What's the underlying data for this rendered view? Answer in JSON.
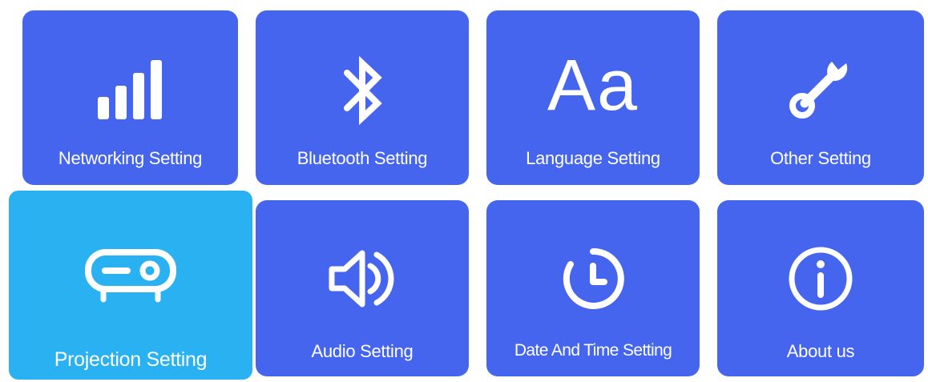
{
  "tiles": [
    {
      "id": "networking",
      "label": "Networking Setting",
      "icon": "signal-bars-icon",
      "focused": false
    },
    {
      "id": "bluetooth",
      "label": "Bluetooth Setting",
      "icon": "bluetooth-icon",
      "focused": false
    },
    {
      "id": "language",
      "label": "Language Setting",
      "icon": "font-aa-icon",
      "icon_text": "Aa",
      "focused": false
    },
    {
      "id": "other",
      "label": "Other Setting",
      "icon": "wrench-icon",
      "focused": false
    },
    {
      "id": "projection",
      "label": "Projection Setting",
      "icon": "projector-icon",
      "focused": true
    },
    {
      "id": "audio",
      "label": "Audio Setting",
      "icon": "speaker-icon",
      "focused": false
    },
    {
      "id": "datetime",
      "label": "Date And Time Setting",
      "icon": "clock-icon",
      "focused": false
    },
    {
      "id": "about",
      "label": "About us",
      "icon": "info-icon",
      "focused": false
    }
  ],
  "colors": {
    "tile": "#4565ee",
    "tile_focused": "#29b1f2",
    "icon": "#ffffff",
    "background": "#ffffff"
  }
}
